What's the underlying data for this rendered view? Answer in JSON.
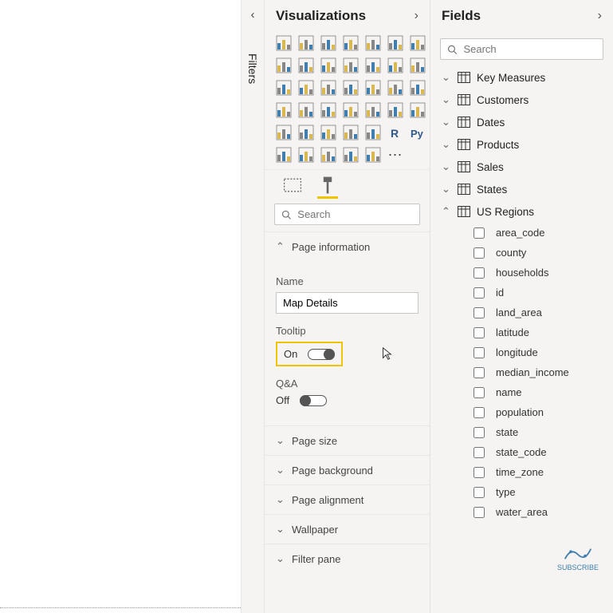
{
  "filters": {
    "label": "Filters"
  },
  "viz": {
    "title": "Visualizations",
    "search_placeholder": "Search",
    "sections": {
      "page_info": {
        "title": "Page information",
        "name_label": "Name",
        "name_value": "Map Details",
        "tooltip_label": "Tooltip",
        "tooltip_state": "On",
        "qa_label": "Q&A",
        "qa_state": "Off"
      },
      "page_size": {
        "title": "Page size"
      },
      "page_bg": {
        "title": "Page background"
      },
      "page_align": {
        "title": "Page alignment"
      },
      "wallpaper": {
        "title": "Wallpaper"
      },
      "filter_pane": {
        "title": "Filter pane"
      }
    },
    "icons": [
      "stacked-bar",
      "clustered-bar",
      "stacked-bar-h",
      "clustered-bar-h",
      "stacked-col",
      "clustered-col",
      "stacked-col-100",
      "line",
      "area",
      "stacked-area",
      "line-col",
      "line-col2",
      "ribbon",
      "waterfall",
      "scatter",
      "funnel",
      "treemap",
      "pie",
      "donut",
      "gauge",
      "card",
      "map",
      "filled-map",
      "arcgis",
      "slicer",
      "kpi",
      "multi-card",
      "table-viz",
      "matrix",
      "table",
      "matrix2",
      "matrix3",
      "decomp",
      "r-visual",
      "py-visual",
      "key-influencers",
      "qa-visual",
      "narrative",
      "paginated",
      "get-more",
      "more"
    ]
  },
  "fields": {
    "title": "Fields",
    "search_placeholder": "Search",
    "tables": [
      {
        "name": "Key Measures",
        "expanded": false
      },
      {
        "name": "Customers",
        "expanded": false
      },
      {
        "name": "Dates",
        "expanded": false
      },
      {
        "name": "Products",
        "expanded": false
      },
      {
        "name": "Sales",
        "expanded": false
      },
      {
        "name": "States",
        "expanded": false
      },
      {
        "name": "US Regions",
        "expanded": true,
        "fields": [
          "area_code",
          "county",
          "households",
          "id",
          "land_area",
          "latitude",
          "longitude",
          "median_income",
          "name",
          "population",
          "state",
          "state_code",
          "time_zone",
          "type",
          "water_area"
        ]
      }
    ]
  },
  "badge": {
    "text": "SUBSCRIBE"
  }
}
